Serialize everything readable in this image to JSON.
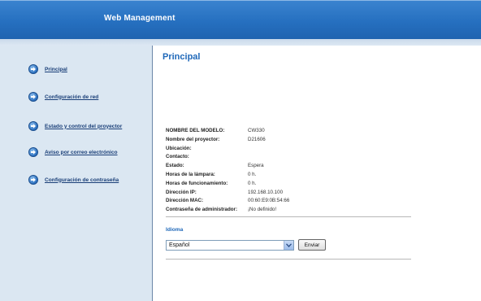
{
  "header": {
    "title": "Web Management"
  },
  "sidebar": {
    "items": [
      {
        "label": "Principal"
      },
      {
        "label": "Configuración de red"
      },
      {
        "label": "Estado y control del proyector"
      },
      {
        "label": "Aviso por correo electrónico"
      },
      {
        "label": "Configuración de contraseña"
      }
    ]
  },
  "main": {
    "title": "Principal",
    "info": [
      {
        "label": "NOMBRE DEL MODELO:",
        "value": "CW330"
      },
      {
        "label": "Nombre del proyector:",
        "value": "D21606"
      },
      {
        "label": "Ubicación:",
        "value": ""
      },
      {
        "label": "Contacto:",
        "value": ""
      },
      {
        "label": "Estado:",
        "value": "Espera"
      },
      {
        "label": "Horas de la lámpara:",
        "value": "0 h."
      },
      {
        "label": "Horas de funcionamiento:",
        "value": "0 h."
      },
      {
        "label": "Dirección IP:",
        "value": "192.168.10.100"
      },
      {
        "label": "Dirección MAC:",
        "value": "00:60:E9:0B:54:66"
      },
      {
        "label": "Contraseña de administrador:",
        "value": "¡No definido!"
      }
    ],
    "language": {
      "label": "Idioma",
      "selected": "Español",
      "submit": "Enviar"
    }
  }
}
